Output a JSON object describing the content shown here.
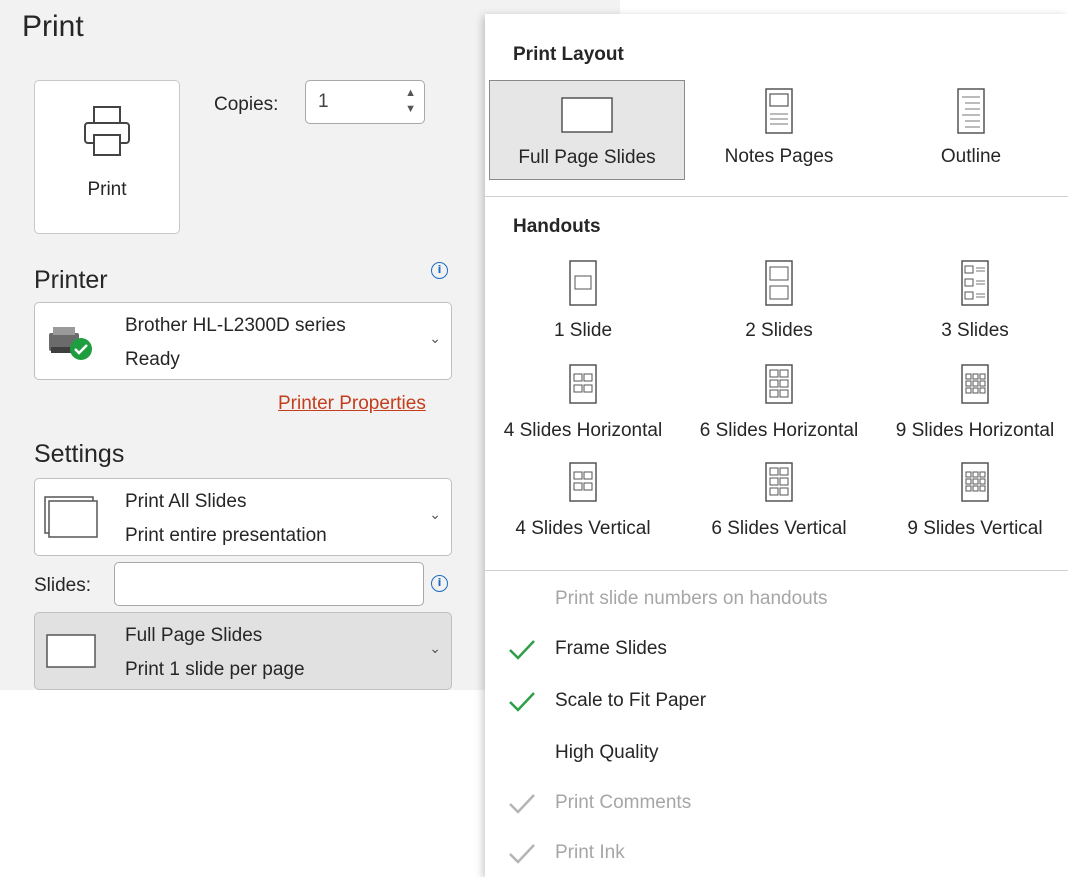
{
  "backstage": {
    "title": "Print",
    "print_button_label": "Print",
    "copies_label": "Copies:",
    "copies_value": "1"
  },
  "printer": {
    "section_title": "Printer",
    "name": "Brother HL-L2300D series",
    "status": "Ready",
    "properties_link": "Printer Properties"
  },
  "settings": {
    "section_title": "Settings",
    "range_primary": "Print All Slides",
    "range_secondary": "Print entire presentation",
    "slides_label": "Slides:",
    "slides_value": "",
    "layout_primary": "Full Page Slides",
    "layout_secondary": "Print 1 slide per page"
  },
  "menu": {
    "print_layout_heading": "Print Layout",
    "layouts": [
      {
        "label": "Full Page Slides",
        "selected": true
      },
      {
        "label": "Notes Pages",
        "selected": false
      },
      {
        "label": "Outline",
        "selected": false
      }
    ],
    "handouts_heading": "Handouts",
    "handouts": [
      {
        "label": "1 Slide"
      },
      {
        "label": "2 Slides"
      },
      {
        "label": "3 Slides"
      },
      {
        "label": "4 Slides Horizontal"
      },
      {
        "label": "6 Slides Horizontal"
      },
      {
        "label": "9 Slides Horizontal"
      },
      {
        "label": "4 Slides Vertical"
      },
      {
        "label": "6 Slides Vertical"
      },
      {
        "label": "9 Slides Vertical"
      }
    ],
    "options": [
      {
        "label": "Print slide numbers on handouts",
        "checked": false,
        "enabled": false
      },
      {
        "label": "Frame Slides",
        "checked": true,
        "enabled": true
      },
      {
        "label": "Scale to Fit Paper",
        "checked": true,
        "enabled": true
      },
      {
        "label": "High Quality",
        "checked": false,
        "enabled": true
      },
      {
        "label": "Print Comments",
        "checked": true,
        "enabled": false
      },
      {
        "label": "Print Ink",
        "checked": true,
        "enabled": false
      }
    ]
  },
  "colors": {
    "link": "#c43e1c",
    "check_enabled": "#2e9e48",
    "check_disabled": "#b4b4b4",
    "info": "#1b6ec2"
  }
}
